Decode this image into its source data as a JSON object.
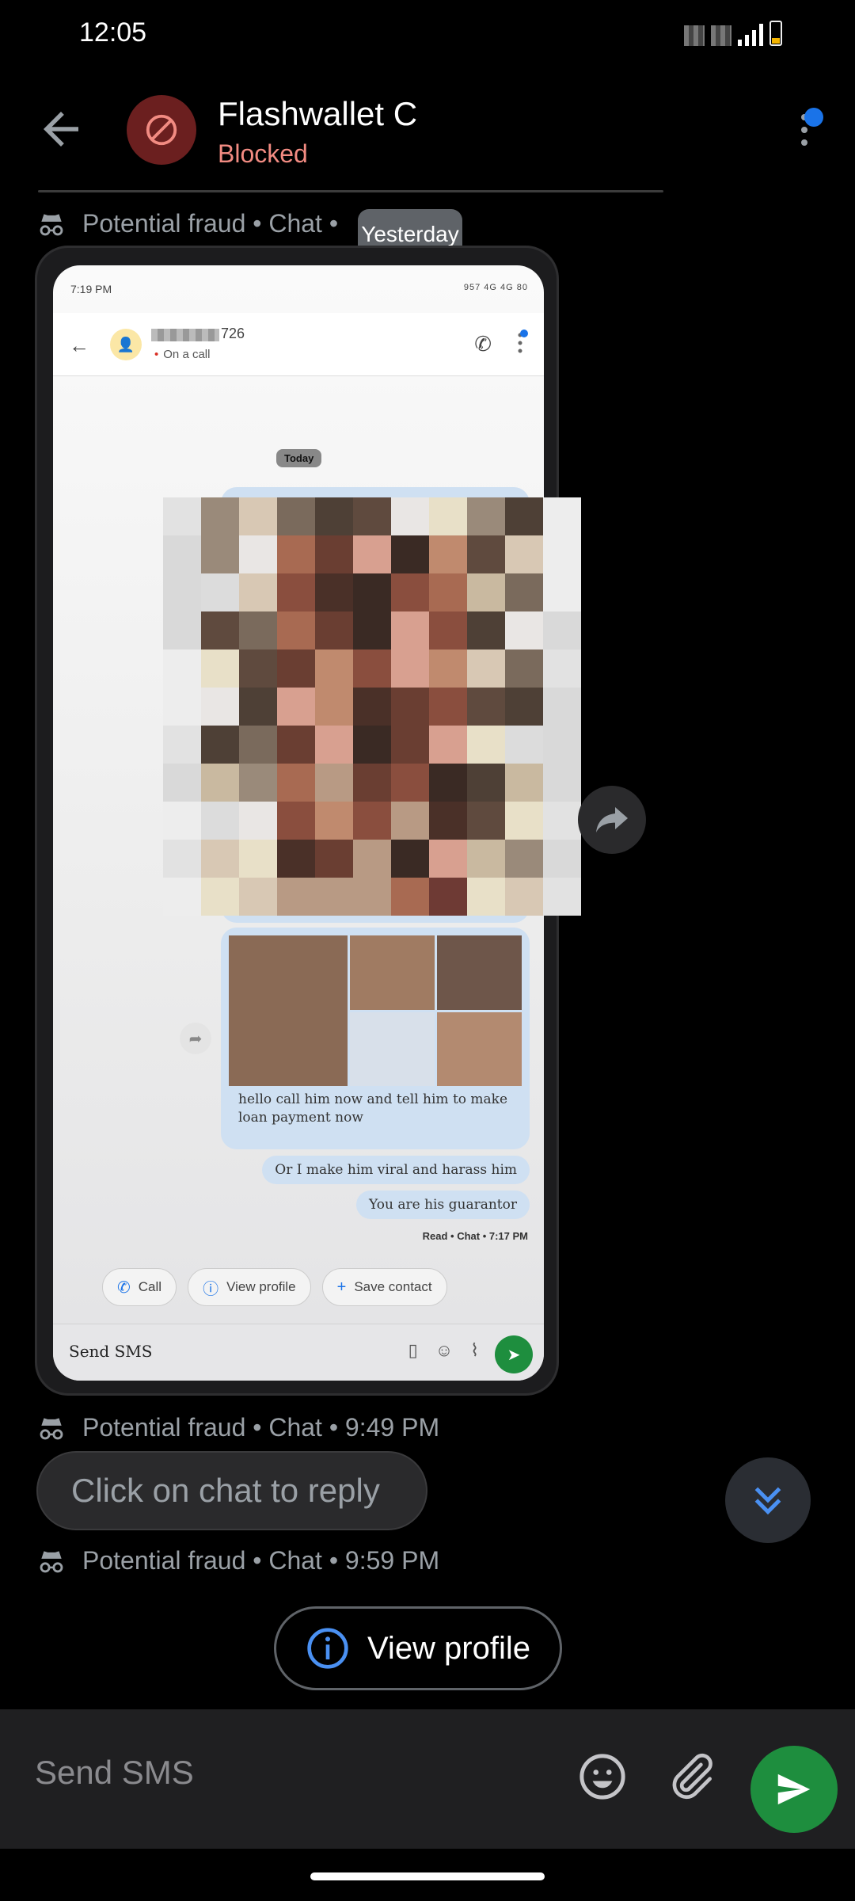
{
  "status_bar": {
    "time": "12:05"
  },
  "header": {
    "contact_name": "Flashwallet C",
    "contact_status": "Blocked"
  },
  "date_chip": "Yesterday",
  "messages": [
    {
      "meta": "Potential fraud • Chat •"
    },
    {
      "meta": "Potential fraud • Chat • 9:49 PM"
    },
    {
      "meta": "Potential fraud • Chat • 9:59 PM"
    }
  ],
  "screenshot": {
    "status_time": "7:19 PM",
    "status_right": "957 4G 4G 80",
    "contact_number": "726",
    "call_status": "On a call",
    "date_label": "Today",
    "caption": "hello call him now and tell him to make loan payment now",
    "msg_viral": "Or I make him viral and harass him",
    "msg_guarantor": "You are his guarantor",
    "read_receipt": "Read • Chat • 7:17 PM",
    "actions": [
      "Call",
      "View profile",
      "Save contact"
    ],
    "compose_placeholder": "Send SMS"
  },
  "reply_chip": "Click on chat to reply",
  "view_profile": "View profile",
  "compose": {
    "placeholder": "Send SMS"
  },
  "colors": {
    "accent": "#1a73e8",
    "send": "#1e8e3e",
    "blocked": "#f28b82"
  }
}
